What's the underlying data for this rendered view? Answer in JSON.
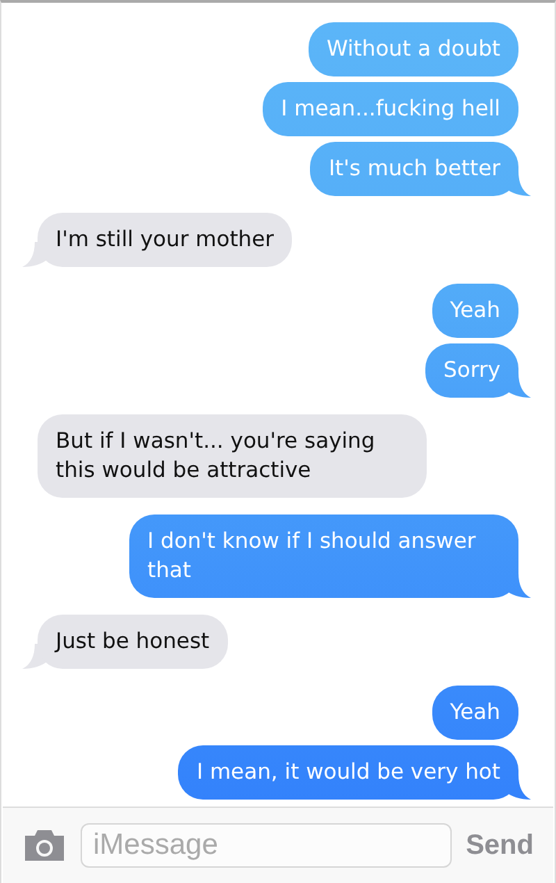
{
  "messages": [
    {
      "kind": "sent",
      "text": "Without a doubt",
      "tail": false
    },
    {
      "kind": "sent",
      "text": "I mean...fucking hell",
      "tail": false
    },
    {
      "kind": "sent",
      "text": "It's much better",
      "tail": true
    },
    {
      "kind": "received",
      "text": "I'm still your mother",
      "tail": true
    },
    {
      "kind": "sent",
      "text": "Yeah",
      "tail": false
    },
    {
      "kind": "sent",
      "text": "Sorry",
      "tail": true
    },
    {
      "kind": "received",
      "text": "But if I wasn't... you're saying this would be attractive",
      "tail": false
    },
    {
      "kind": "sent",
      "text": "I don't know if I should answer that",
      "tail": true
    },
    {
      "kind": "received",
      "text": "Just be honest",
      "tail": true
    },
    {
      "kind": "sent",
      "text": "Yeah",
      "tail": false
    },
    {
      "kind": "sent",
      "text": "I mean, it would be very hot",
      "tail": true
    }
  ],
  "composer": {
    "placeholder": "iMessage",
    "send": "Send"
  }
}
